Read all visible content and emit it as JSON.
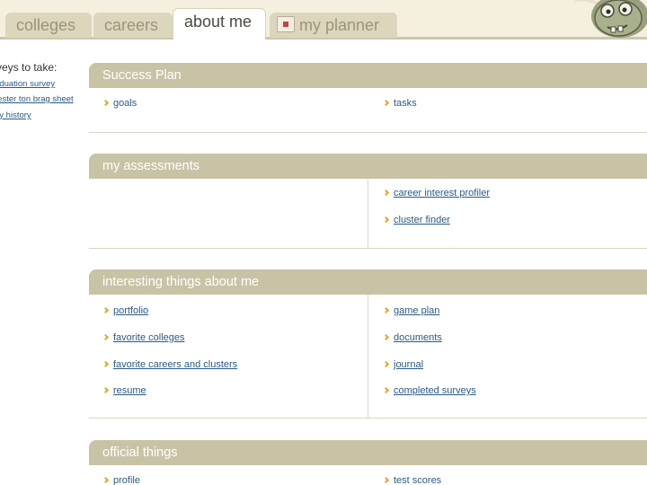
{
  "tabs": [
    {
      "label": "colleges",
      "active": false
    },
    {
      "label": "careers",
      "active": false
    },
    {
      "label": "about me",
      "active": true
    },
    {
      "label": "my planner",
      "active": false
    }
  ],
  "left": {
    "heading": "veys to take:",
    "links": [
      "aduation survey",
      "rester ton brag sheet",
      "ey history"
    ]
  },
  "sections": {
    "success_plan": {
      "title": "Success Plan",
      "left": [
        "goals"
      ],
      "right": [
        "tasks"
      ]
    },
    "assessments": {
      "title": "my assessments",
      "right": [
        "career interest profiler",
        "cluster finder"
      ]
    },
    "interesting": {
      "title": "interesting things about me",
      "left": [
        "portfolio",
        "favorite colleges",
        "favorite careers and clusters",
        "resume"
      ],
      "right": [
        "game plan",
        "documents",
        "journal",
        "completed surveys"
      ]
    },
    "official": {
      "title": "official things",
      "left": [
        "profile"
      ],
      "right": [
        "test scores"
      ]
    }
  },
  "colors": {
    "header_bg": "#c8c3a5",
    "link": "#2a5a84",
    "arrow": "#e3a52a"
  }
}
